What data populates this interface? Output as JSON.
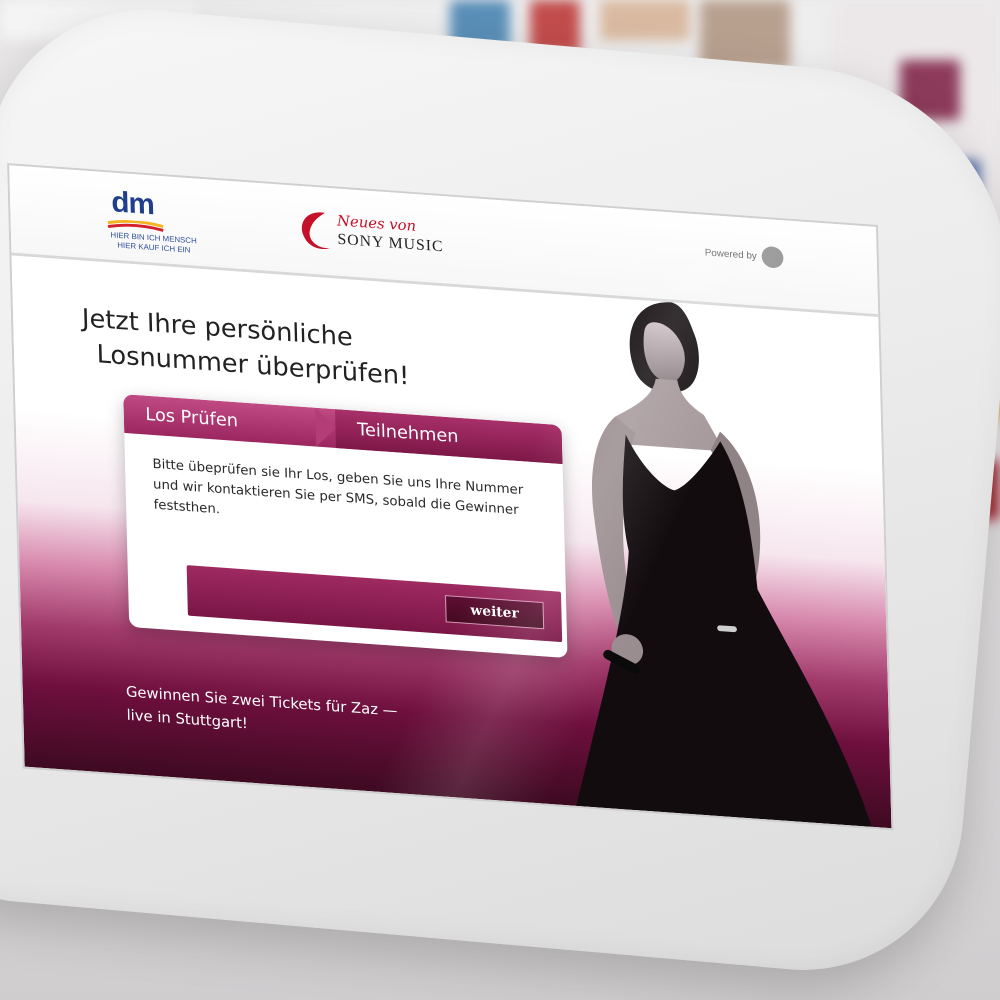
{
  "header": {
    "dm_logo": {
      "letters": "dm",
      "tagline_line1": "HIER BIN ICH MENSCH",
      "tagline_line2": "HIER KAUF ICH EIN"
    },
    "sony_logo": {
      "neues": "Neues von",
      "sony": "SONY MUSIC"
    },
    "powered_by": "Powered by"
  },
  "main": {
    "headline_line1": "Jetzt Ihre persönliche",
    "headline_line2": "Losnummer überprüfen!",
    "tabs": [
      {
        "label": "Los Prüfen"
      },
      {
        "label": "Teilnehmen"
      }
    ],
    "card_text": "Bitte übeprüfen sie Ihr Los, geben Sie uns Ihre Nummer und wir kontaktieren Sie per SMS, sobald die Gewinner feststhen.",
    "input": {
      "value": "",
      "placeholder": ""
    },
    "weiter_label": "weiter",
    "promo_line1": "Gewinnen Sie zwei Tickets für Zaz —",
    "promo_line2": "live in Stuttgart!"
  },
  "colors": {
    "brand_magenta": "#9c2660",
    "dark_magenta": "#6e0f3d",
    "dm_blue": "#1f3f8c",
    "sony_red": "#c5102a"
  }
}
